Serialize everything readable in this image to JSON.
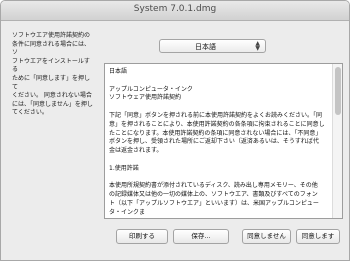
{
  "window": {
    "title": "System 7.0.1.dmg"
  },
  "side_text": "ソフトウエア使用許諾契約の\n条件に同意される場合には、ソ\nフトウエアをインストールする\nために「同意します」を押して\nください。 同意されない場合\nには、「同意しません」を押し\nてください。",
  "language": {
    "selected": "日本語"
  },
  "license": {
    "text": "日本語\n\nアップルコンピュータ・インク\nソフトウェア使用許諾契約\n\n下記「同意」ボタンを押される前に本使用許諾契約をよくお読みください。「同\n意」を押されることにより、本使用許諾契約の各条項に拘束されることに同意し\nたことになります。本使用許諾契約の条項に同意されない場合には、「不同意」\nボタンを押し、受領された場所にご返却下さい（返済あるいは、そうすれば代\n金は返金されます。\n\n1.使用許諾\n\n本使用所規契約書が添付されているディスク、読み出し専用メモリー、その他\nの記録媒体又は他の一切の媒体上の、ソフトウエア、書類及びすべてのフォン\nト（以下「アップルソフトウエア」といいます）は、米国アップルコンピュータ・インクま"
  },
  "buttons": {
    "print": "印刷する",
    "save": "保存...",
    "disagree": "同意しません",
    "agree": "同意します"
  }
}
